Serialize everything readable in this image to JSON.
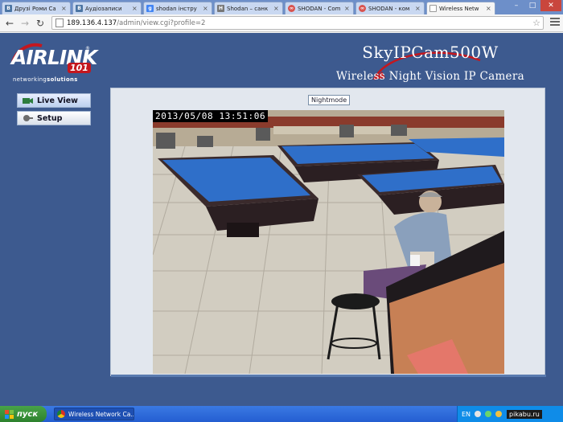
{
  "browser": {
    "tabs": [
      {
        "label": "Друзі Роми Са",
        "favicon": "vk-icon",
        "active": false
      },
      {
        "label": "Аудіозаписи",
        "favicon": "vk-icon",
        "active": false
      },
      {
        "label": "shodan інстру",
        "favicon": "google-icon",
        "active": false
      },
      {
        "label": "Shodan – санк",
        "favicon": "hacker-news-icon",
        "active": false
      },
      {
        "label": "SHODAN - Com",
        "favicon": "shodan-icon",
        "active": false
      },
      {
        "label": "SHODAN - ком",
        "favicon": "shodan-icon",
        "active": false
      },
      {
        "label": "Wireless Netw",
        "favicon": "page-icon",
        "active": true
      }
    ],
    "address": {
      "host": "189.136.4.137",
      "path": "/admin/view.cgi?profile=2"
    },
    "window_controls": {
      "minimize": "–",
      "maximize": "□",
      "close": "✕"
    }
  },
  "page": {
    "logo": {
      "brand": "AIRLINK",
      "badge": "101",
      "registered": "®",
      "tagline_a": "networking",
      "tagline_b": "solutions"
    },
    "product": {
      "model": "SkyIPCam500W",
      "subtitle": "Wireless Night Vision IP Camera"
    },
    "sidebar": {
      "live_view_label": "Live View",
      "setup_label": "Setup"
    },
    "camera": {
      "nightmode_label": "Nightmode",
      "timestamp": "2013/05/08 13:51:06"
    }
  },
  "taskbar": {
    "start_label": "пуск",
    "task_label": "Wireless Network Ca...",
    "language": "EN",
    "watermark": "pikabu.ru"
  },
  "colors": {
    "page_bg": "#3d5a8f",
    "brand_red": "#c4171e",
    "table_felt": "#2f6fc9",
    "taskbar_blue": "#245ed1"
  }
}
